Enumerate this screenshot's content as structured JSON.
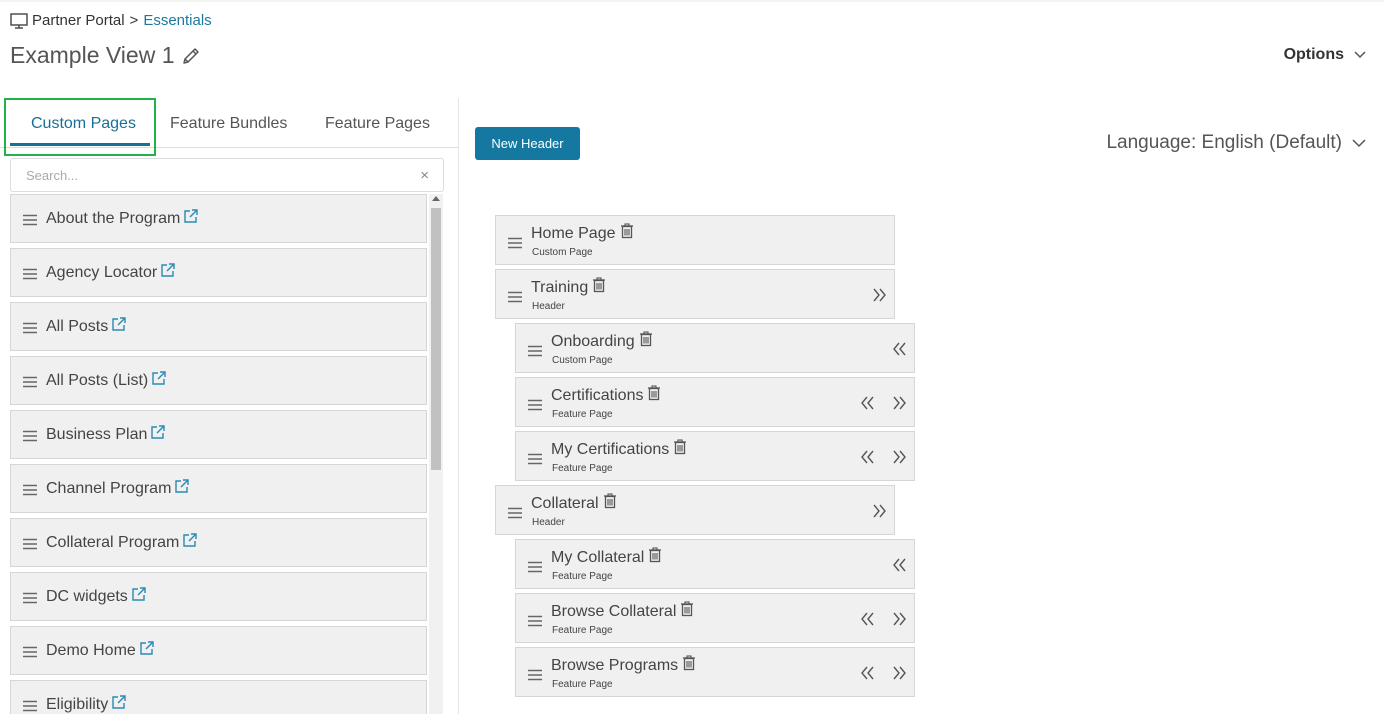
{
  "breadcrumb": {
    "icon": "monitor-icon",
    "root": "Partner Portal",
    "separator": ">",
    "current": "Essentials"
  },
  "page_title": "Example View 1",
  "options_label": "Options",
  "tabs": [
    {
      "label": "Custom Pages",
      "active": true
    },
    {
      "label": "Feature Bundles",
      "active": false
    },
    {
      "label": "Feature Pages",
      "active": false
    }
  ],
  "search": {
    "placeholder": "Search...",
    "value": "",
    "clear_icon": "×"
  },
  "custom_pages": [
    "About the Program",
    "Agency Locator",
    "All Posts",
    "All Posts (List)",
    "Business Plan",
    "Channel Program",
    "Collateral Program",
    "DC widgets",
    "Demo Home",
    "Eligibility"
  ],
  "new_header_label": "New Header",
  "language_label": "Language: English (Default)",
  "navigation": [
    {
      "name": "Home Page",
      "type": "Custom Page",
      "level": 0,
      "indent_left": false,
      "indent_right": false
    },
    {
      "name": "Training",
      "type": "Header",
      "level": 0,
      "indent_left": false,
      "indent_right": true
    },
    {
      "name": "Onboarding",
      "type": "Custom Page",
      "level": 1,
      "indent_left": true,
      "indent_right": false
    },
    {
      "name": "Certifications",
      "type": "Feature Page",
      "level": 1,
      "indent_left": true,
      "indent_right": true
    },
    {
      "name": "My Certifications",
      "type": "Feature Page",
      "level": 1,
      "indent_left": true,
      "indent_right": true
    },
    {
      "name": "Collateral",
      "type": "Header",
      "level": 0,
      "indent_left": false,
      "indent_right": true
    },
    {
      "name": "My Collateral",
      "type": "Feature Page",
      "level": 1,
      "indent_left": true,
      "indent_right": false
    },
    {
      "name": "Browse Collateral",
      "type": "Feature Page",
      "level": 1,
      "indent_left": true,
      "indent_right": true
    },
    {
      "name": "Browse Programs",
      "type": "Feature Page",
      "level": 1,
      "indent_left": true,
      "indent_right": true
    }
  ],
  "colors": {
    "accent": "#1578a0",
    "link": "#1a7a9c",
    "tab_highlight": "#22b24c",
    "item_bg": "#f0f0f0"
  }
}
